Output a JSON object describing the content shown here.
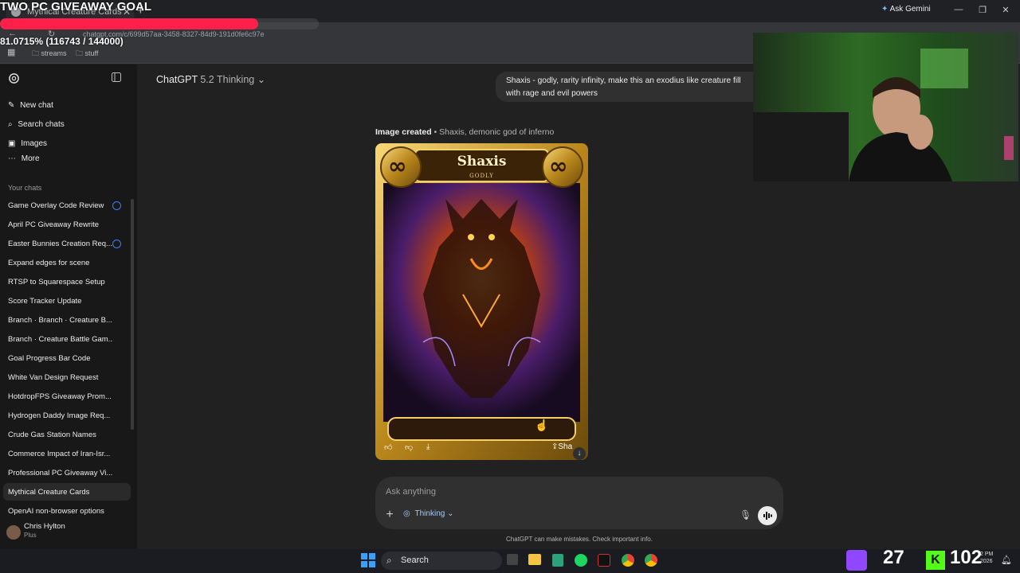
{
  "browser": {
    "tab_title": "Mythical Creature Cards",
    "url": "chatgpt.com/c/699d57aa-3458-8327-84d9-191d0fe6c97e",
    "ask_gemini": "Ask Gemini",
    "bookmarks": [
      "streams",
      "stuff"
    ]
  },
  "overlay": {
    "goal_title": "TWO PC GIVEAWAY GOAL",
    "goal_progress_percent": 81.0715,
    "goal_text": "81.0715% (116743 / 144000)",
    "bar_color": "#ff1f4b"
  },
  "sidebar": {
    "new_chat": "New chat",
    "search_chats": "Search chats",
    "images": "Images",
    "more": "More",
    "section_label": "Your chats",
    "chats": [
      "Game Overlay Code Review",
      "April PC Giveaway Rewrite",
      "Easter Bunnies Creation Req...",
      "Expand edges for scene",
      "RTSP to Squarespace Setup",
      "Score Tracker Update",
      "Branch · Branch · Creature B...",
      "Branch · Creature Battle Gam...",
      "Goal Progress Bar Code",
      "White Van Design Request",
      "HotdropFPS Giveaway Prom...",
      "Hydrogen Daddy Image Req...",
      "Crude Gas Station Names",
      "Commerce Impact of Iran-Isr...",
      "Professional PC Giveaway Vi...",
      "Mythical Creature Cards",
      "OpenAI non-browser options"
    ],
    "user_name": "Chris Hylton",
    "user_plan": "Plus"
  },
  "header": {
    "model_name": "ChatGPT",
    "model_version": "5.2 Thinking"
  },
  "conversation": {
    "user_message_line1": "Shaxis - godly, rarity infinity, make this an exodius like creature fill",
    "user_message_line2": "with rage and evil powers",
    "image_caption_bold": "Image created",
    "image_caption_rest": " • Shaxis, demonic god of inferno",
    "card_name": "Shaxis",
    "card_rarity": "GODLY",
    "card_symbol": "∞",
    "share_label": "Sha"
  },
  "composer": {
    "placeholder": "Ask anything",
    "mode_label": "Thinking",
    "disclaimer": "ChatGPT can make mistakes. Check important info."
  },
  "taskbar": {
    "search_label": "Search",
    "stat_left": "27",
    "stat_right": "102",
    "clock_time": "2 PM",
    "clock_date": "2026"
  },
  "colors": {
    "accent": "#3b82f6",
    "sidebar_bg": "#181818",
    "main_bg": "#212121"
  }
}
